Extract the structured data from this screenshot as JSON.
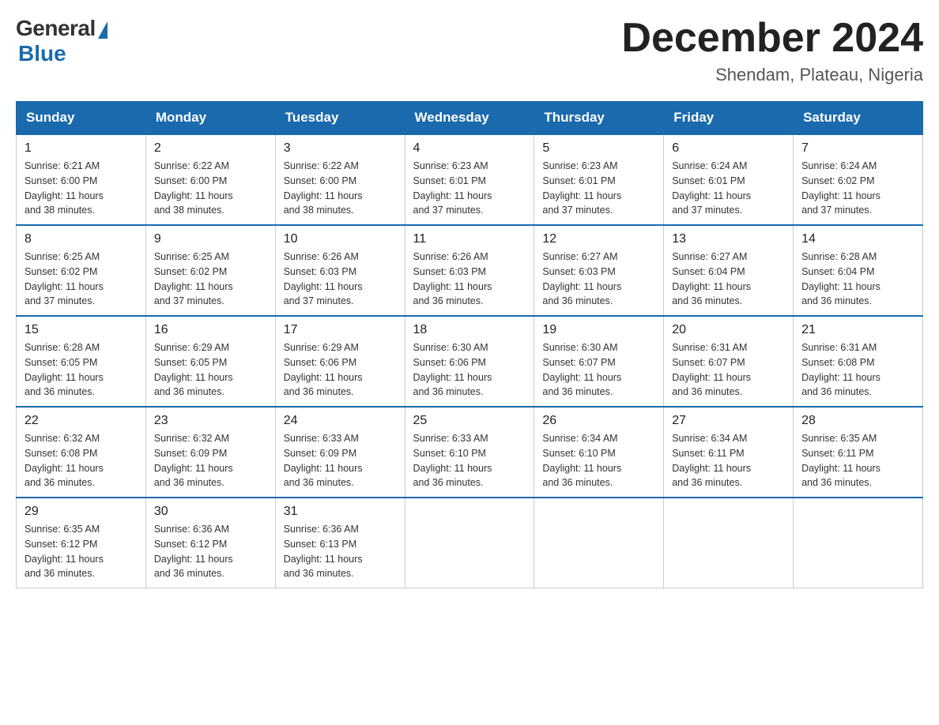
{
  "logo": {
    "general": "General",
    "blue": "Blue"
  },
  "title": {
    "month_year": "December 2024",
    "location": "Shendam, Plateau, Nigeria"
  },
  "weekdays": [
    "Sunday",
    "Monday",
    "Tuesday",
    "Wednesday",
    "Thursday",
    "Friday",
    "Saturday"
  ],
  "weeks": [
    [
      {
        "day": "1",
        "sunrise": "6:21 AM",
        "sunset": "6:00 PM",
        "daylight": "11 hours and 38 minutes."
      },
      {
        "day": "2",
        "sunrise": "6:22 AM",
        "sunset": "6:00 PM",
        "daylight": "11 hours and 38 minutes."
      },
      {
        "day": "3",
        "sunrise": "6:22 AM",
        "sunset": "6:00 PM",
        "daylight": "11 hours and 38 minutes."
      },
      {
        "day": "4",
        "sunrise": "6:23 AM",
        "sunset": "6:01 PM",
        "daylight": "11 hours and 37 minutes."
      },
      {
        "day": "5",
        "sunrise": "6:23 AM",
        "sunset": "6:01 PM",
        "daylight": "11 hours and 37 minutes."
      },
      {
        "day": "6",
        "sunrise": "6:24 AM",
        "sunset": "6:01 PM",
        "daylight": "11 hours and 37 minutes."
      },
      {
        "day": "7",
        "sunrise": "6:24 AM",
        "sunset": "6:02 PM",
        "daylight": "11 hours and 37 minutes."
      }
    ],
    [
      {
        "day": "8",
        "sunrise": "6:25 AM",
        "sunset": "6:02 PM",
        "daylight": "11 hours and 37 minutes."
      },
      {
        "day": "9",
        "sunrise": "6:25 AM",
        "sunset": "6:02 PM",
        "daylight": "11 hours and 37 minutes."
      },
      {
        "day": "10",
        "sunrise": "6:26 AM",
        "sunset": "6:03 PM",
        "daylight": "11 hours and 37 minutes."
      },
      {
        "day": "11",
        "sunrise": "6:26 AM",
        "sunset": "6:03 PM",
        "daylight": "11 hours and 36 minutes."
      },
      {
        "day": "12",
        "sunrise": "6:27 AM",
        "sunset": "6:03 PM",
        "daylight": "11 hours and 36 minutes."
      },
      {
        "day": "13",
        "sunrise": "6:27 AM",
        "sunset": "6:04 PM",
        "daylight": "11 hours and 36 minutes."
      },
      {
        "day": "14",
        "sunrise": "6:28 AM",
        "sunset": "6:04 PM",
        "daylight": "11 hours and 36 minutes."
      }
    ],
    [
      {
        "day": "15",
        "sunrise": "6:28 AM",
        "sunset": "6:05 PM",
        "daylight": "11 hours and 36 minutes."
      },
      {
        "day": "16",
        "sunrise": "6:29 AM",
        "sunset": "6:05 PM",
        "daylight": "11 hours and 36 minutes."
      },
      {
        "day": "17",
        "sunrise": "6:29 AM",
        "sunset": "6:06 PM",
        "daylight": "11 hours and 36 minutes."
      },
      {
        "day": "18",
        "sunrise": "6:30 AM",
        "sunset": "6:06 PM",
        "daylight": "11 hours and 36 minutes."
      },
      {
        "day": "19",
        "sunrise": "6:30 AM",
        "sunset": "6:07 PM",
        "daylight": "11 hours and 36 minutes."
      },
      {
        "day": "20",
        "sunrise": "6:31 AM",
        "sunset": "6:07 PM",
        "daylight": "11 hours and 36 minutes."
      },
      {
        "day": "21",
        "sunrise": "6:31 AM",
        "sunset": "6:08 PM",
        "daylight": "11 hours and 36 minutes."
      }
    ],
    [
      {
        "day": "22",
        "sunrise": "6:32 AM",
        "sunset": "6:08 PM",
        "daylight": "11 hours and 36 minutes."
      },
      {
        "day": "23",
        "sunrise": "6:32 AM",
        "sunset": "6:09 PM",
        "daylight": "11 hours and 36 minutes."
      },
      {
        "day": "24",
        "sunrise": "6:33 AM",
        "sunset": "6:09 PM",
        "daylight": "11 hours and 36 minutes."
      },
      {
        "day": "25",
        "sunrise": "6:33 AM",
        "sunset": "6:10 PM",
        "daylight": "11 hours and 36 minutes."
      },
      {
        "day": "26",
        "sunrise": "6:34 AM",
        "sunset": "6:10 PM",
        "daylight": "11 hours and 36 minutes."
      },
      {
        "day": "27",
        "sunrise": "6:34 AM",
        "sunset": "6:11 PM",
        "daylight": "11 hours and 36 minutes."
      },
      {
        "day": "28",
        "sunrise": "6:35 AM",
        "sunset": "6:11 PM",
        "daylight": "11 hours and 36 minutes."
      }
    ],
    [
      {
        "day": "29",
        "sunrise": "6:35 AM",
        "sunset": "6:12 PM",
        "daylight": "11 hours and 36 minutes."
      },
      {
        "day": "30",
        "sunrise": "6:36 AM",
        "sunset": "6:12 PM",
        "daylight": "11 hours and 36 minutes."
      },
      {
        "day": "31",
        "sunrise": "6:36 AM",
        "sunset": "6:13 PM",
        "daylight": "11 hours and 36 minutes."
      },
      null,
      null,
      null,
      null
    ]
  ],
  "labels": {
    "sunrise": "Sunrise:",
    "sunset": "Sunset:",
    "daylight": "Daylight:"
  }
}
